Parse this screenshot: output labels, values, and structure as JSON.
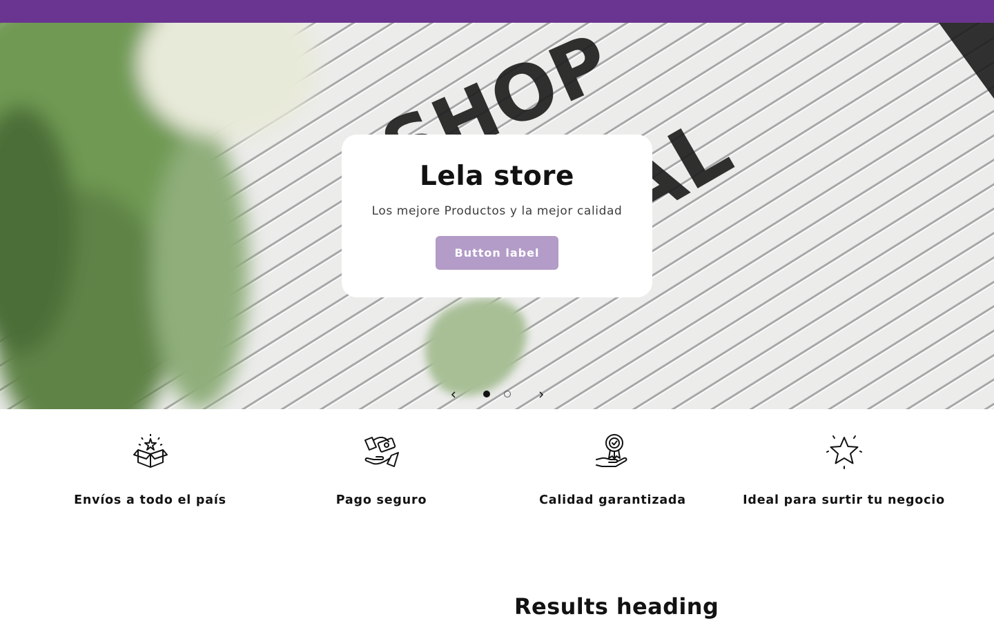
{
  "hero": {
    "title": "Lela store",
    "subtitle": "Los mejore Productos y la mejor calidad",
    "button_label": "Button label"
  },
  "slider": {
    "slide_count": 2,
    "active_slide": 1
  },
  "features": [
    {
      "icon": "gift-box-icon",
      "label": "Envíos a todo el país"
    },
    {
      "icon": "payment-hands-icon",
      "label": "Pago seguro"
    },
    {
      "icon": "quality-badge-icon",
      "label": "Calidad garantizada"
    },
    {
      "icon": "star-icon",
      "label": "Ideal para surtir tu negocio"
    }
  ],
  "results": {
    "heading": "Results heading"
  },
  "colors": {
    "announcement_bar": "#6a3590",
    "button": "#b39cc8",
    "text": "#121212"
  }
}
